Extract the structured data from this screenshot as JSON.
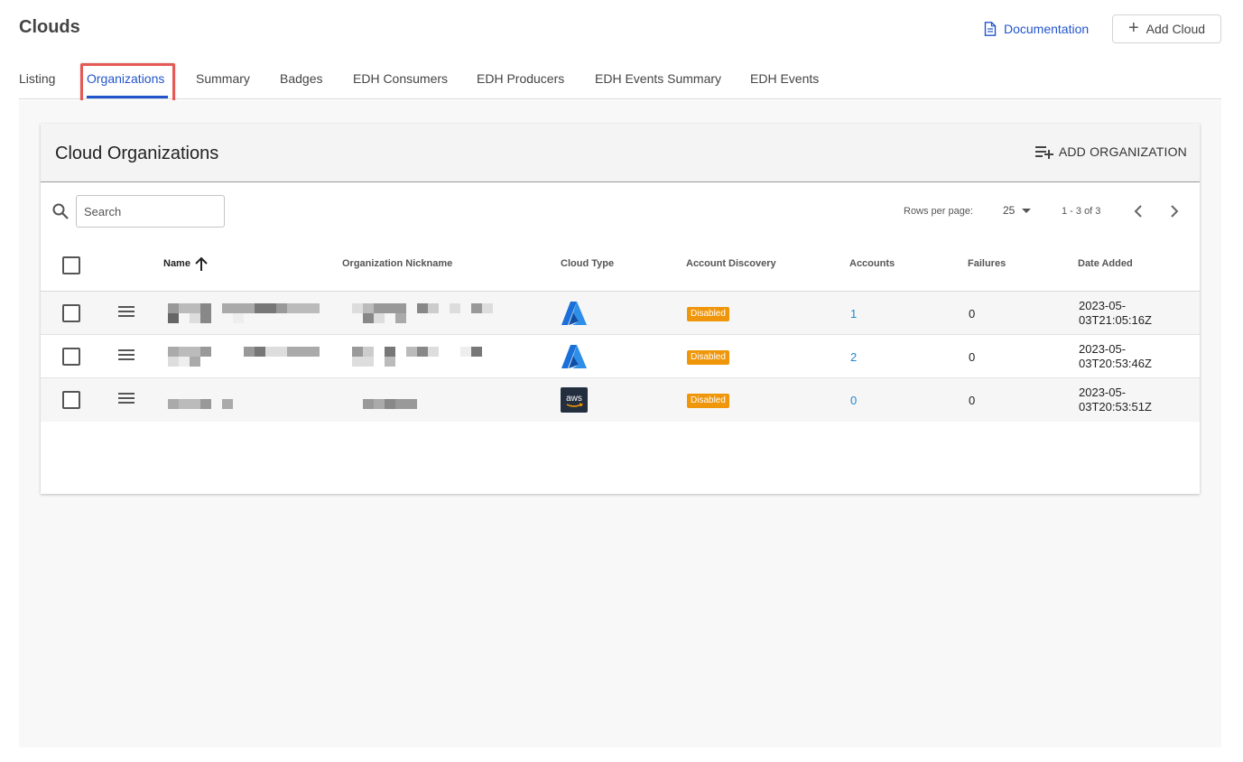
{
  "page": {
    "title": "Clouds",
    "documentation_label": "Documentation",
    "add_cloud_label": "Add Cloud"
  },
  "tabs": [
    {
      "label": "Listing",
      "active": false
    },
    {
      "label": "Organizations",
      "active": true
    },
    {
      "label": "Summary",
      "active": false
    },
    {
      "label": "Badges",
      "active": false
    },
    {
      "label": "EDH Consumers",
      "active": false
    },
    {
      "label": "EDH Producers",
      "active": false
    },
    {
      "label": "EDH Events Summary",
      "active": false
    },
    {
      "label": "EDH Events",
      "active": false
    }
  ],
  "card": {
    "title": "Cloud Organizations",
    "add_label": "ADD ORGANIZATION"
  },
  "search": {
    "placeholder": "Search",
    "value": ""
  },
  "pagination": {
    "rows_per_page_label": "Rows per page:",
    "rows_per_page": "25",
    "range": "1 - 3 of 3"
  },
  "table": {
    "columns": {
      "name": "Name",
      "nickname": "Organization Nickname",
      "cloud_type": "Cloud Type",
      "discovery": "Account Discovery",
      "accounts": "Accounts",
      "failures": "Failures",
      "date_added": "Date Added"
    },
    "sort": {
      "column": "Name",
      "direction": "ascending"
    },
    "rows": [
      {
        "cloud_icon": "azure-logo-icon",
        "discovery": "Disabled",
        "accounts": "1",
        "failures": "0",
        "date_added": "2023-05-03T21:05:16Z"
      },
      {
        "cloud_icon": "azure-logo-icon",
        "discovery": "Disabled",
        "accounts": "2",
        "failures": "0",
        "date_added": "2023-05-03T20:53:46Z"
      },
      {
        "cloud_icon": "aws-logo-icon",
        "discovery": "Disabled",
        "accounts": "0",
        "failures": "0",
        "date_added": "2023-05-03T20:53:51Z"
      }
    ]
  },
  "colors": {
    "accent": "#2255cc",
    "highlight_box": "#e55a54",
    "badge_disabled": "#f0960a",
    "link": "#1f88d0"
  }
}
